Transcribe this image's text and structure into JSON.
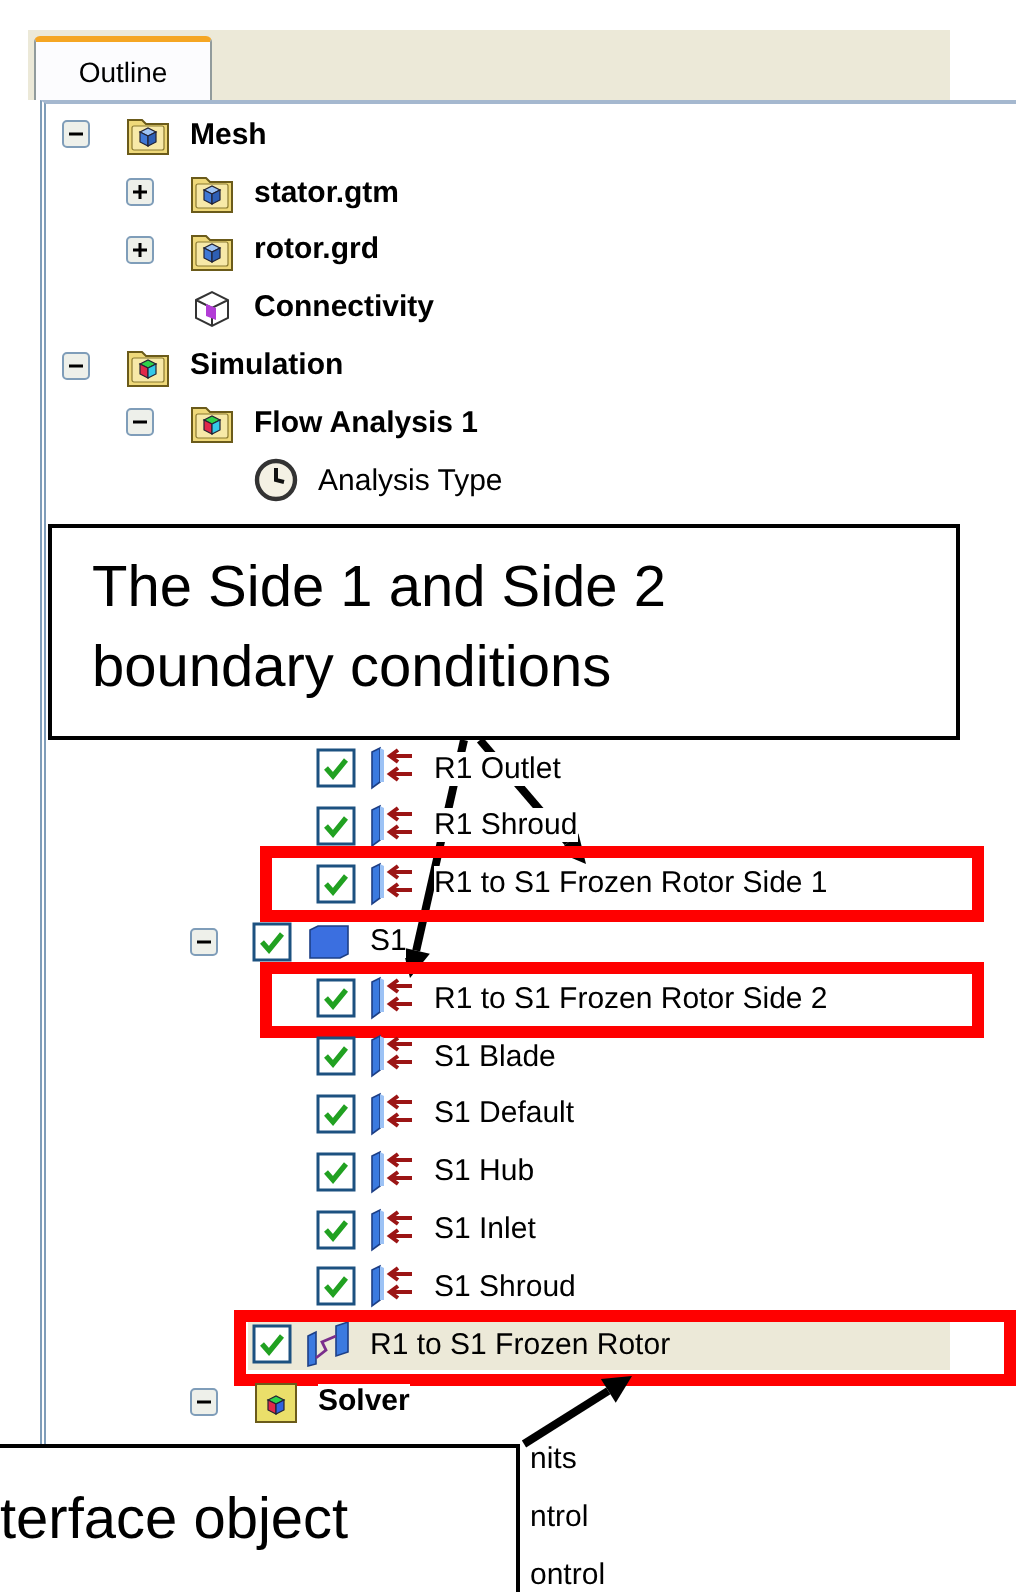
{
  "tab": {
    "label": "Outline",
    "selected": true
  },
  "tree": [
    {
      "label": "Mesh",
      "kind": "folder-mesh",
      "bold": true,
      "expanded": true,
      "children": [
        {
          "label": "stator.gtm",
          "kind": "folder-mesh",
          "bold": true,
          "expanded": false
        },
        {
          "label": "rotor.grd",
          "kind": "folder-mesh",
          "bold": true,
          "expanded": false
        },
        {
          "label": "Connectivity",
          "kind": "connectivity",
          "bold": true
        }
      ]
    },
    {
      "label": "Simulation",
      "kind": "folder-sim",
      "bold": true,
      "expanded": true,
      "children": [
        {
          "label": "Flow Analysis 1",
          "kind": "folder-sim",
          "bold": true,
          "expanded": true,
          "children": [
            {
              "label": "Analysis Type",
              "kind": "clock"
            },
            {
              "children": [
                {
                  "label": "R1 Outlet",
                  "kind": "boundary",
                  "checked": true
                },
                {
                  "label": "R1 Shroud",
                  "kind": "boundary",
                  "checked": true
                },
                {
                  "label": "R1 to S1 Frozen Rotor Side 1",
                  "kind": "boundary",
                  "checked": true,
                  "outlined": true
                }
              ]
            },
            {
              "label": "S1",
              "kind": "domain",
              "checked": true,
              "expanded": true,
              "children": [
                {
                  "label": "R1 to S1 Frozen Rotor Side 2",
                  "kind": "boundary",
                  "checked": true,
                  "outlined": true
                },
                {
                  "label": "S1 Blade",
                  "kind": "boundary",
                  "checked": true
                },
                {
                  "label": "S1 Default",
                  "kind": "boundary",
                  "checked": true
                },
                {
                  "label": "S1 Hub",
                  "kind": "boundary",
                  "checked": true
                },
                {
                  "label": "S1 Inlet",
                  "kind": "boundary",
                  "checked": true
                },
                {
                  "label": "S1 Shroud",
                  "kind": "boundary",
                  "checked": true
                }
              ]
            },
            {
              "label": "R1 to S1 Frozen Rotor",
              "kind": "interface",
              "checked": true,
              "selected": true,
              "outlined": true
            },
            {
              "label": "Solver",
              "kind": "solver",
              "bold": true,
              "expanded": true,
              "children": [
                {
                  "label": "nits",
                  "kind": "partial"
                },
                {
                  "label": "ntrol",
                  "kind": "partial"
                },
                {
                  "label": "ontrol",
                  "kind": "partial"
                }
              ]
            }
          ]
        }
      ]
    }
  ],
  "callouts": [
    {
      "text": "The Side 1 and Side 2 boundary conditions"
    },
    {
      "text": "terface object"
    }
  ]
}
